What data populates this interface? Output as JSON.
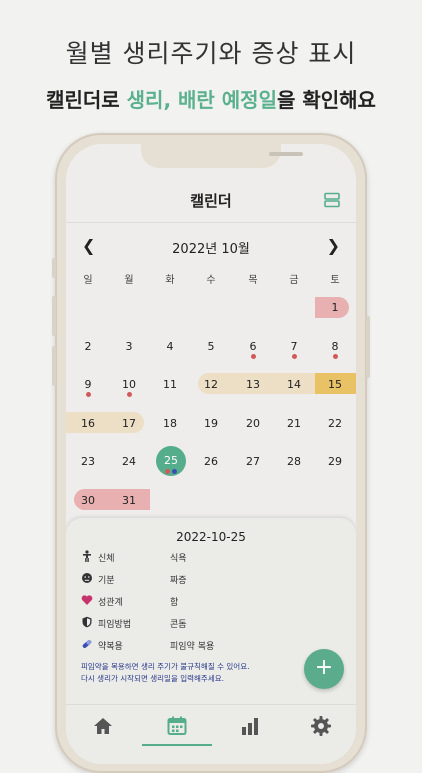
{
  "headline": "월별 생리주기와 증상 표시",
  "subheadline": {
    "pre": "캘린더로 ",
    "highlight": "생리, 배란 예정일",
    "post": "을 확인해요"
  },
  "app": {
    "title": "캘린더",
    "month_label": "2022년 10월",
    "prev_icon": "chevron-left",
    "next_icon": "chevron-right",
    "view_icon": "split-view",
    "weekdays": [
      "일",
      "월",
      "화",
      "수",
      "목",
      "금",
      "토"
    ],
    "weeks": [
      [
        "",
        "",
        "",
        "",
        "",
        "",
        "1"
      ],
      [
        "2",
        "3",
        "4",
        "5",
        "6",
        "7",
        "8"
      ],
      [
        "9",
        "10",
        "11",
        "12",
        "13",
        "14",
        "15"
      ],
      [
        "16",
        "17",
        "18",
        "19",
        "20",
        "21",
        "22"
      ],
      [
        "23",
        "24",
        "25",
        "26",
        "27",
        "28",
        "29"
      ],
      [
        "30",
        "31",
        "",
        "",
        "",
        "",
        ""
      ]
    ],
    "colors": {
      "accent": "#55ad8c",
      "period": "#e8b0b0",
      "fertile": "#ecdfc6",
      "ovulation": "#e9c265",
      "symptom_dot": "#d05a5a",
      "note_text": "#2a3a8a"
    }
  },
  "detail": {
    "date": "2022-10-25",
    "rows": [
      {
        "icon": "body-icon",
        "label": "신체",
        "value": "식욕"
      },
      {
        "icon": "mood-icon",
        "label": "기분",
        "value": "짜증"
      },
      {
        "icon": "heart-icon",
        "label": "성관계",
        "value": "함"
      },
      {
        "icon": "shield-icon",
        "label": "피임방법",
        "value": "콘돔"
      },
      {
        "icon": "pill-icon",
        "label": "약복용",
        "value": "피임약 복용"
      }
    ],
    "note_line1": "피임약을 복용하면 생리 주기가 불규칙해질 수 있어요.",
    "note_line2": "다시 생리가 시작되면 생리일을 입력해주세요."
  },
  "fab_label": "+",
  "tabs": [
    {
      "name": "home",
      "icon": "home-icon"
    },
    {
      "name": "calendar",
      "icon": "calendar-icon",
      "active": true
    },
    {
      "name": "stats",
      "icon": "bar-chart-icon"
    },
    {
      "name": "settings",
      "icon": "gear-icon"
    }
  ]
}
